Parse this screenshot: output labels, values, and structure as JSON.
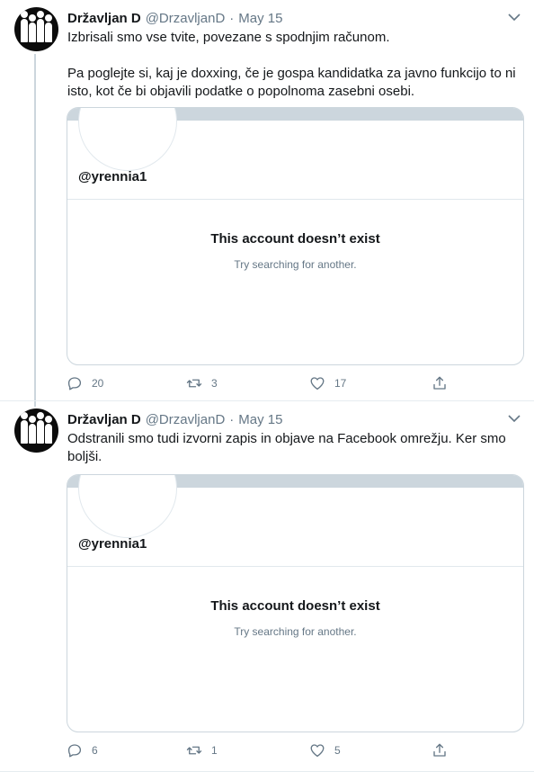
{
  "tweets": [
    {
      "name": "Državljan D",
      "handle": "@DrzavljanD",
      "separator": "·",
      "date": "May 15",
      "paragraphs": [
        "Izbrisali smo vse tvite, povezane s spodnjim računom.",
        "Pa poglejte si, kaj je doxxing, če je gospa kandidatka za javno funkcijo to ni isto, kot če bi objavili podatke o popolnoma zasebni osebi."
      ],
      "card": {
        "username": "@yrennia1",
        "title": "This account doesn’t exist",
        "subtitle": "Try searching for another."
      },
      "replies": "20",
      "retweets": "3",
      "likes": "17"
    },
    {
      "name": "Državljan D",
      "handle": "@DrzavljanD",
      "separator": "·",
      "date": "May 15",
      "paragraphs": [
        "Odstranili smo tudi izvorni zapis in objave na Facebook omrežju. Ker smo boljši."
      ],
      "card": {
        "username": "@yrennia1",
        "title": "This account doesn’t exist",
        "subtitle": "Try searching for another."
      },
      "replies": "6",
      "retweets": "1",
      "likes": "5"
    }
  ],
  "icons": {
    "reply": "reply-icon",
    "retweet": "retweet-icon",
    "like": "heart-icon",
    "share": "share-icon",
    "caret": "chevron-down-icon"
  },
  "colors": {
    "text": "#14171a",
    "secondary": "#657786",
    "border": "#ccd6dd",
    "thread_line": "#ccd6dd"
  }
}
